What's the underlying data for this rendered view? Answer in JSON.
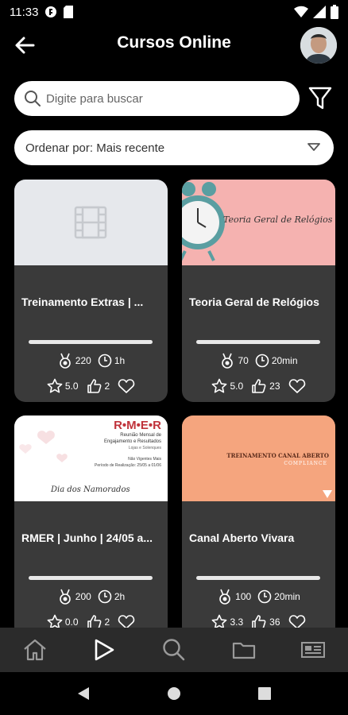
{
  "status_bar": {
    "time": "11:33"
  },
  "header": {
    "title": "Cursos Online"
  },
  "search": {
    "placeholder": "Digite para buscar"
  },
  "sort": {
    "label": "Ordenar por: Mais recente"
  },
  "courses": [
    {
      "title": "Treinamento Extras | ...",
      "points": "220",
      "duration": "1h",
      "rating": "5.0",
      "likes": "2",
      "progress": 0,
      "thumb": {
        "type": "placeholder"
      }
    },
    {
      "title": "Teoria Geral de Relógios",
      "points": "70",
      "duration": "20min",
      "rating": "5.0",
      "likes": "23",
      "progress": 0,
      "thumb": {
        "type": "image",
        "text": "Teoria Geral de Relógios"
      }
    },
    {
      "title": "RMER | Junho | 24/05 a...",
      "points": "200",
      "duration": "2h",
      "rating": "0.0",
      "likes": "2",
      "progress": 0,
      "thumb": {
        "type": "image",
        "brand": "R•M•E•R",
        "line1": "Reunião Mensal de",
        "line2": "Engajamento e Resultados",
        "line3": "Lojas e Solenques",
        "line4": "Não Vigentes Mais",
        "line5": "Período de Realização: 25/05 a 01/06",
        "footer": "Dia dos Namorados"
      }
    },
    {
      "title": "Canal Aberto Vivara",
      "points": "100",
      "duration": "20min",
      "rating": "3.3",
      "likes": "36",
      "progress": 0,
      "thumb": {
        "type": "image",
        "line1": "TREINAMENTO CANAL ABERTO",
        "line2": "COMPLIANCE"
      }
    }
  ],
  "colors": {
    "card_bg": "#3a3a3a",
    "accent": "#ffffff"
  }
}
